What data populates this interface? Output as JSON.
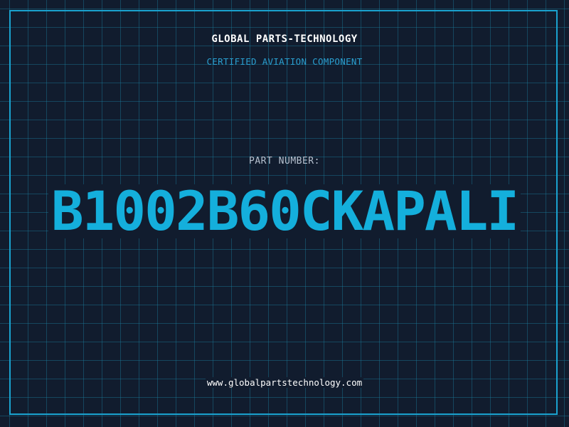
{
  "header": {
    "brand": "GLOBAL PARTS-TECHNOLOGY",
    "tagline": "CERTIFIED AVIATION COMPONENT"
  },
  "part": {
    "label": "PART NUMBER:",
    "number": "B1002B60CKAPALI"
  },
  "footer": {
    "website": "www.globalpartstechnology.com"
  },
  "colors": {
    "background": "#111c2e",
    "grid": "#1a80a0",
    "frame": "#1aa2cf",
    "accent": "#14afdc",
    "tagline": "#2a9fd0",
    "label": "#b7c2d0",
    "text": "#ffffff"
  }
}
